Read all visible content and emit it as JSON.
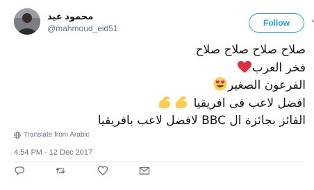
{
  "tweet": {
    "author": {
      "name": "محمود عيد",
      "handle": "@mahmoud_eid51"
    },
    "follow_label": "Follow",
    "lines": [
      "صلاح صلاح صلاح صلاح",
      "فخر العرب",
      "الفرعون الصغير",
      "افضل لاعب فى افريقيا",
      "الفائز بجائزة ال BBC لافضل لاعب بافريقيا"
    ],
    "translate_label": "Translate from Arabic",
    "timestamp": "4:54 PM - 12 Dec 2017"
  },
  "colors": {
    "accent": "#1da1f2",
    "secondary_text": "#657786",
    "heart": "#e0245e"
  },
  "icons": [
    "reply-icon",
    "retweet-icon",
    "like-icon",
    "dm-icon",
    "globe-icon",
    "chevron-down-icon",
    "red-heart-emoji",
    "heart-eyes-emoji",
    "flexed-biceps-emoji"
  ]
}
